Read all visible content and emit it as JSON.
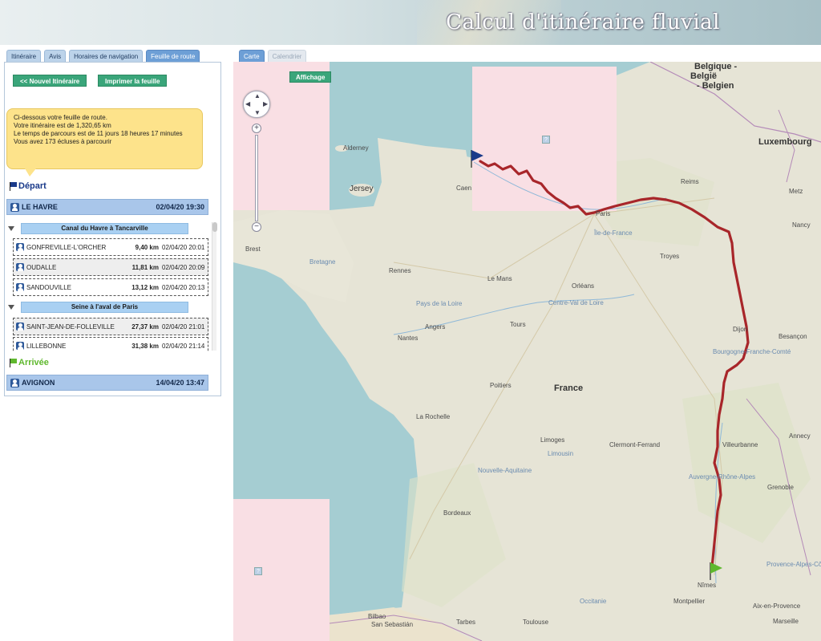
{
  "header": {
    "title": "Calcul d'itinéraire fluvial"
  },
  "left_tabs": [
    "Itinéraire",
    "Avis",
    "Horaires de navigation",
    "Feuille de route"
  ],
  "buttons": {
    "new_itinerary": "<< Nouvel Itinéraire",
    "print_sheet": "Imprimer la feuille"
  },
  "info": {
    "line1": "Ci-dessous votre feuille de route.",
    "line2": "Votre itinéraire est de 1,320,65 km",
    "line3": "Le temps de parcours est de 11 jours 18 heures 17 minutes",
    "line4": "Vous avez 173 écluses à parcourir"
  },
  "departure": {
    "label": "Départ",
    "place": "LE HAVRE",
    "datetime": "02/04/20 19:30"
  },
  "arrival": {
    "label": "Arrivée",
    "place": "AVIGNON",
    "datetime": "14/04/20 13:47"
  },
  "segments": [
    {
      "name": "Canal du Havre à Tancarville",
      "locks": [
        {
          "name": "GONFREVILLE-L'ORCHER",
          "km": "9,40 km",
          "datetime": "02/04/20 20:01"
        },
        {
          "name": "OUDALLE",
          "km": "11,81 km",
          "datetime": "02/04/20 20:09"
        },
        {
          "name": "SANDOUVILLE",
          "km": "13,12 km",
          "datetime": "02/04/20 20:13"
        }
      ]
    },
    {
      "name": "Seine à l'aval de Paris",
      "locks": [
        {
          "name": "SAINT-JEAN-DE-FOLLEVILLE",
          "km": "27,37 km",
          "datetime": "02/04/20 21:01"
        },
        {
          "name": "LILLEBONNE",
          "km": "31,38 km",
          "datetime": "02/04/20 21:14"
        }
      ]
    }
  ],
  "right_tabs": [
    "Carte",
    "Calendrier"
  ],
  "map": {
    "affichage": "Affichage",
    "labels": {
      "belgique": "Belgique -",
      "belgique2": "België",
      "belgique3": "- Belgien",
      "luxembourg": "Luxembourg",
      "alderney": "Alderney",
      "jersey": "Jersey",
      "caen": "Caen",
      "paris": "Paris",
      "ile_de_france": "Île-de-France",
      "reims": "Reims",
      "metz": "Metz",
      "nancy": "Nancy",
      "brest": "Brest",
      "bretagne": "Bretagne",
      "rennes": "Rennes",
      "le_mans": "Le Mans",
      "troyes": "Troyes",
      "orleans": "Orléans",
      "pays_de_la_loire": "Pays de la Loire",
      "centre_val_de_loire": "Centre-Val de Loire",
      "angers": "Angers",
      "tours": "Tours",
      "nantes": "Nantes",
      "dijon": "Dijon",
      "besancon": "Besançon",
      "bourgogne": "Bourgogne-Franche-Comté",
      "france": "France",
      "poitiers": "Poitiers",
      "la_rochelle": "La Rochelle",
      "limoges": "Limoges",
      "limousin": "Limousin",
      "clermont": "Clermont-Ferrand",
      "villeurbanne": "Villeurbanne",
      "annecy": "Annecy",
      "nouvelle_aquitaine": "Nouvelle-Aquitaine",
      "auvergne": "Auvergne-Rhône-Alpes",
      "grenoble": "Grenoble",
      "bordeaux": "Bordeaux",
      "nimes": "Nîmes",
      "montpellier": "Montpellier",
      "occitanie": "Occitanie",
      "provence": "Provence-Alpes-Côte d'Azur",
      "aix": "Aix-en-Provence",
      "marseille": "Marseille",
      "bilbao": "Bilbao",
      "san_sebastian": "San Sebastián",
      "tarbes": "Tarbes",
      "toulouse": "Toulouse"
    }
  },
  "colors": {
    "route": "#a8262a",
    "sea": "#a5cdd2",
    "land": "#e6e4d6",
    "missing_tile": "#f9dfe4",
    "accent_button": "#3aa57a",
    "bubble": "#fde38b"
  }
}
